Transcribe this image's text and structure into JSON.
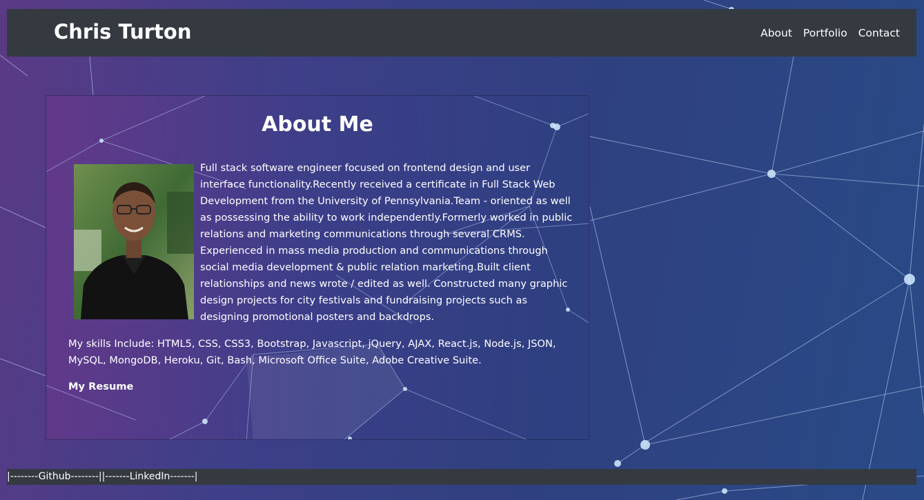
{
  "navbar": {
    "brand": "Chris Turton",
    "links": [
      "About",
      "Portfolio",
      "Contact"
    ]
  },
  "about": {
    "title": "About Me",
    "bio": "Full stack software engineer focused on frontend design and user interface functionality.Recently received a certificate in Full Stack Web Development from the University of Pennsylvania.Team - oriented as well as possessing the ability to work independently.Formerly worked in public relations and marketing communications through several CRMS. Experienced in mass media production and communications through social media development & public relation marketing.Built client relationships and news wrote / edited as well. Constructed many graphic design projects for city festivals and fundraising projects such as designing promotional posters and backdrops.",
    "skills": "My skills Include: HTML5, CSS, CSS3, Bootstrap, Javascript, jQuery, AJAX, React.js, Node.js, JSON, MySQL, MongoDB, Heroku, Git, Bash, Microsoft Office Suite, Adobe Creative Suite.",
    "resume_link": "My Resume"
  },
  "footer": {
    "github": "|--------Github--------|",
    "linkedin": "|-------LinkedIn-------|"
  },
  "colors": {
    "navbar_bg": "#343a40",
    "text": "#ffffff"
  }
}
